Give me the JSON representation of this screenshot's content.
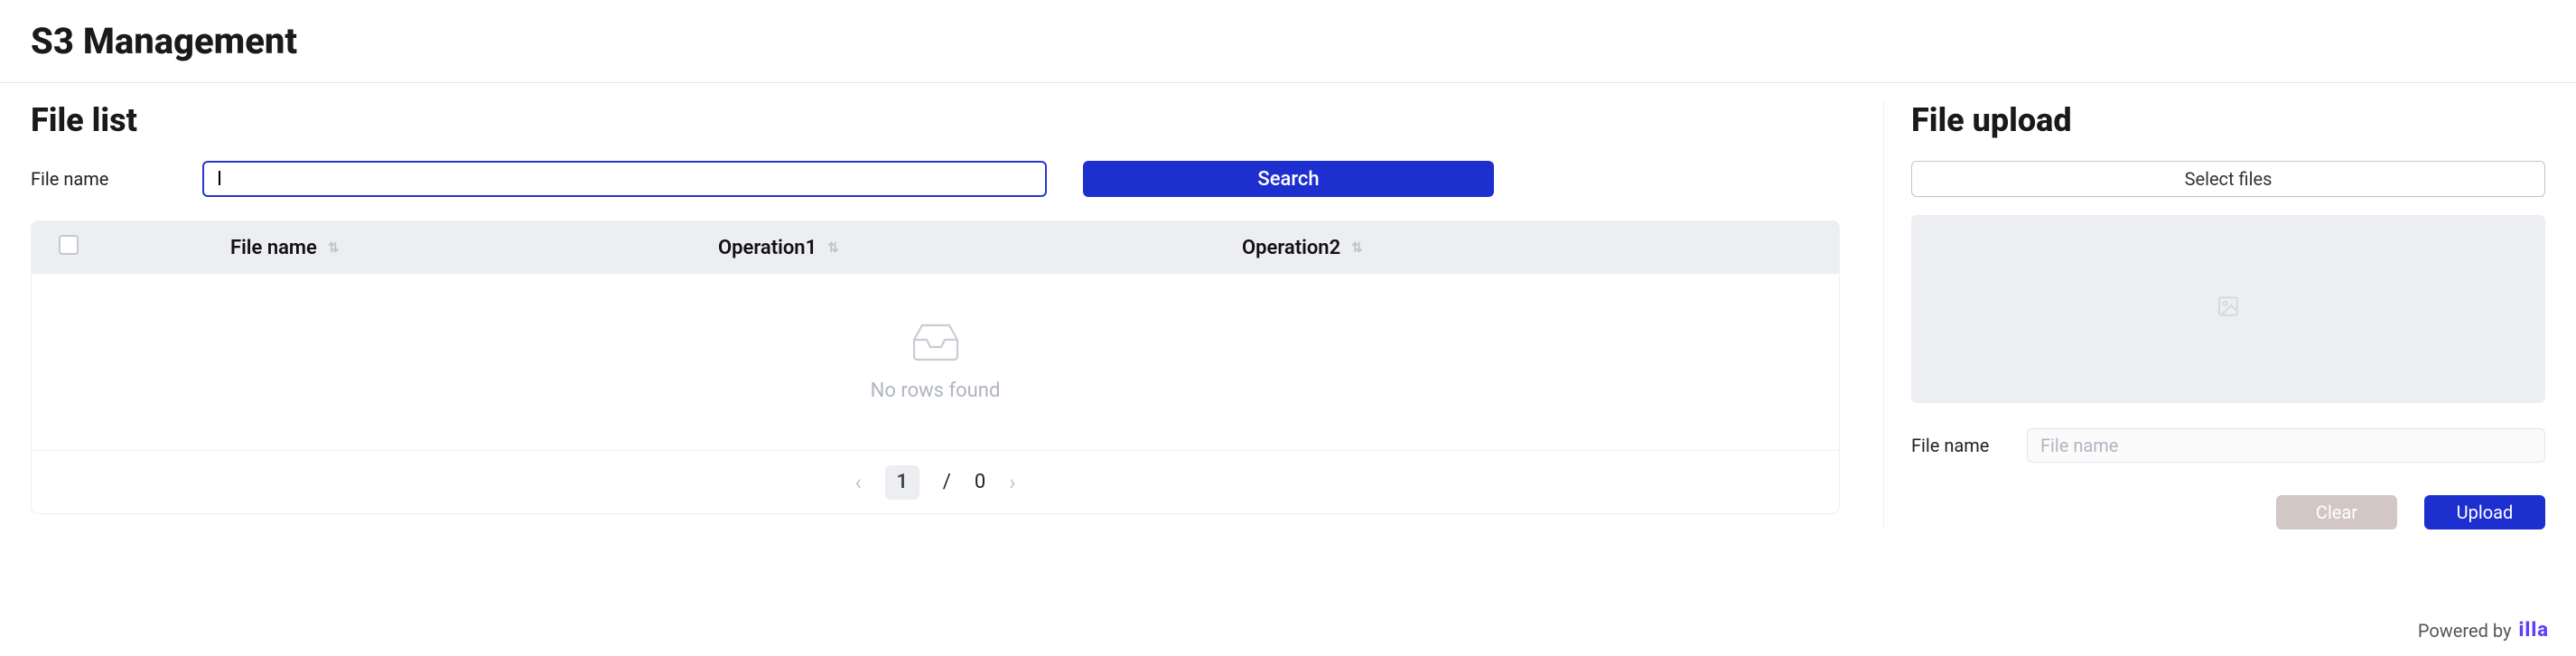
{
  "header": {
    "title": "S3 Management"
  },
  "file_list": {
    "title": "File list",
    "search_label": "File name",
    "search_value": "I",
    "search_button": "Search",
    "columns": {
      "file_name": "File name",
      "op1": "Operation1",
      "op2": "Operation2"
    },
    "empty_text": "No rows found",
    "pagination": {
      "current": "1",
      "separator": "/",
      "total": "0"
    }
  },
  "file_upload": {
    "title": "File upload",
    "select_files": "Select files",
    "file_name_label": "File name",
    "file_name_value": "",
    "file_name_placeholder": "File name",
    "clear": "Clear",
    "upload": "Upload"
  },
  "footer": {
    "powered_by": "Powered by",
    "brand": "illa"
  }
}
